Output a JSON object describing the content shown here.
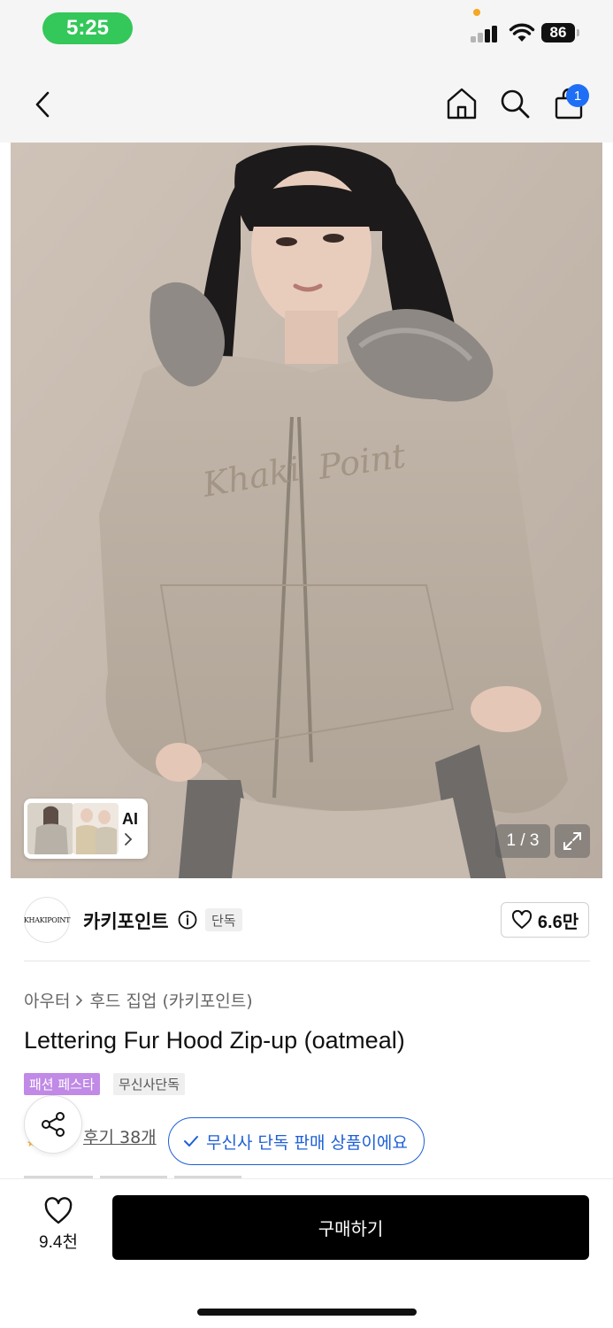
{
  "status_bar": {
    "time": "5:25",
    "battery": "86",
    "icons": [
      "signal-icon",
      "wifi-icon",
      "battery-icon"
    ]
  },
  "nav": {
    "icons": [
      "back-chevron-icon",
      "home-icon",
      "search-icon",
      "shopping-bag-icon"
    ],
    "cart_badge": "1",
    "accent_color": "#1e6ff5"
  },
  "gallery": {
    "ai_label": "AI",
    "page_indicator": "1 / 3",
    "embroidered_text": "Khaki Point"
  },
  "brand": {
    "logo_text": "KHAKIPOINT",
    "name": "카키포인트",
    "badge": "단독",
    "likes": "6.6만"
  },
  "product": {
    "breadcrumb": [
      "아우터",
      "후드 집업 (카키포인트)"
    ],
    "title": "Lettering Fur Hood Zip-up (oatmeal)",
    "tags": [
      "패션 페스타",
      "무신사단독"
    ],
    "tag_colors": [
      "#c08ae6",
      "#efefef"
    ],
    "review_link": "후기 38개",
    "exclusive_notice": "무신사 단독 판매 상품이에요"
  },
  "bottom_bar": {
    "wish_count": "9.4천",
    "buy_label": "구매하기"
  }
}
